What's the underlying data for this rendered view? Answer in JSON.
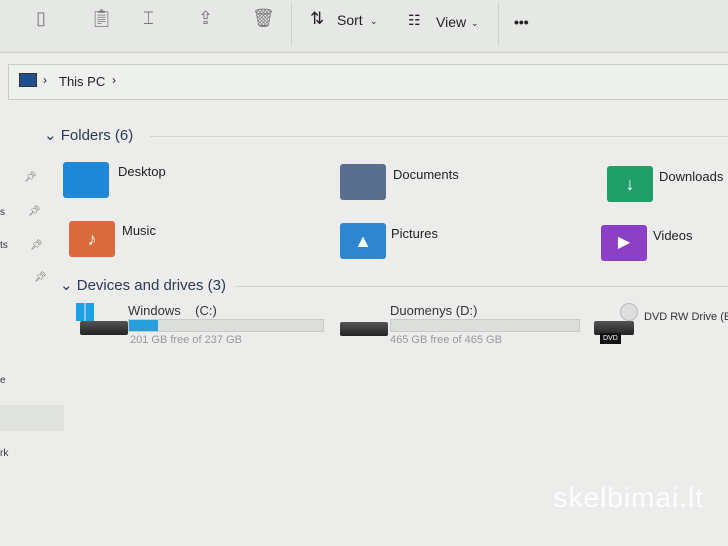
{
  "toolbar": {
    "sort_label": "Sort",
    "view_label": "View",
    "more_label": "•••",
    "icons": [
      "copy-icon",
      "paste-icon",
      "rename-icon",
      "share-icon",
      "delete-icon"
    ]
  },
  "address": {
    "crumbs": [
      "This PC"
    ]
  },
  "folders": {
    "header": "Folders (6)",
    "items": [
      {
        "label": "Desktop",
        "color": "#1e88d6"
      },
      {
        "label": "Documents",
        "color": "#5a6f8d"
      },
      {
        "label": "Downloads",
        "color": "#1f9e6a"
      },
      {
        "label": "Music",
        "color": "#d96a3b"
      },
      {
        "label": "Pictures",
        "color": "#2f86d0"
      },
      {
        "label": "Videos",
        "color": "#8a3fc4"
      }
    ]
  },
  "drives": {
    "header": "Devices and drives (3)",
    "items": [
      {
        "label": "Windows    (C:)",
        "space": "201 GB free of 237 GB",
        "used_fraction": 0.15
      },
      {
        "label": "Duomenys (D:)",
        "space": "465 GB free of 465 GB",
        "used_fraction": 0.0
      },
      {
        "label": "DVD RW Drive (E:",
        "badge": "DVD"
      }
    ]
  },
  "sidebar": {
    "fragments": [
      "s",
      "ts",
      "e",
      "rk"
    ]
  },
  "watermark": "skelbimai.lt"
}
